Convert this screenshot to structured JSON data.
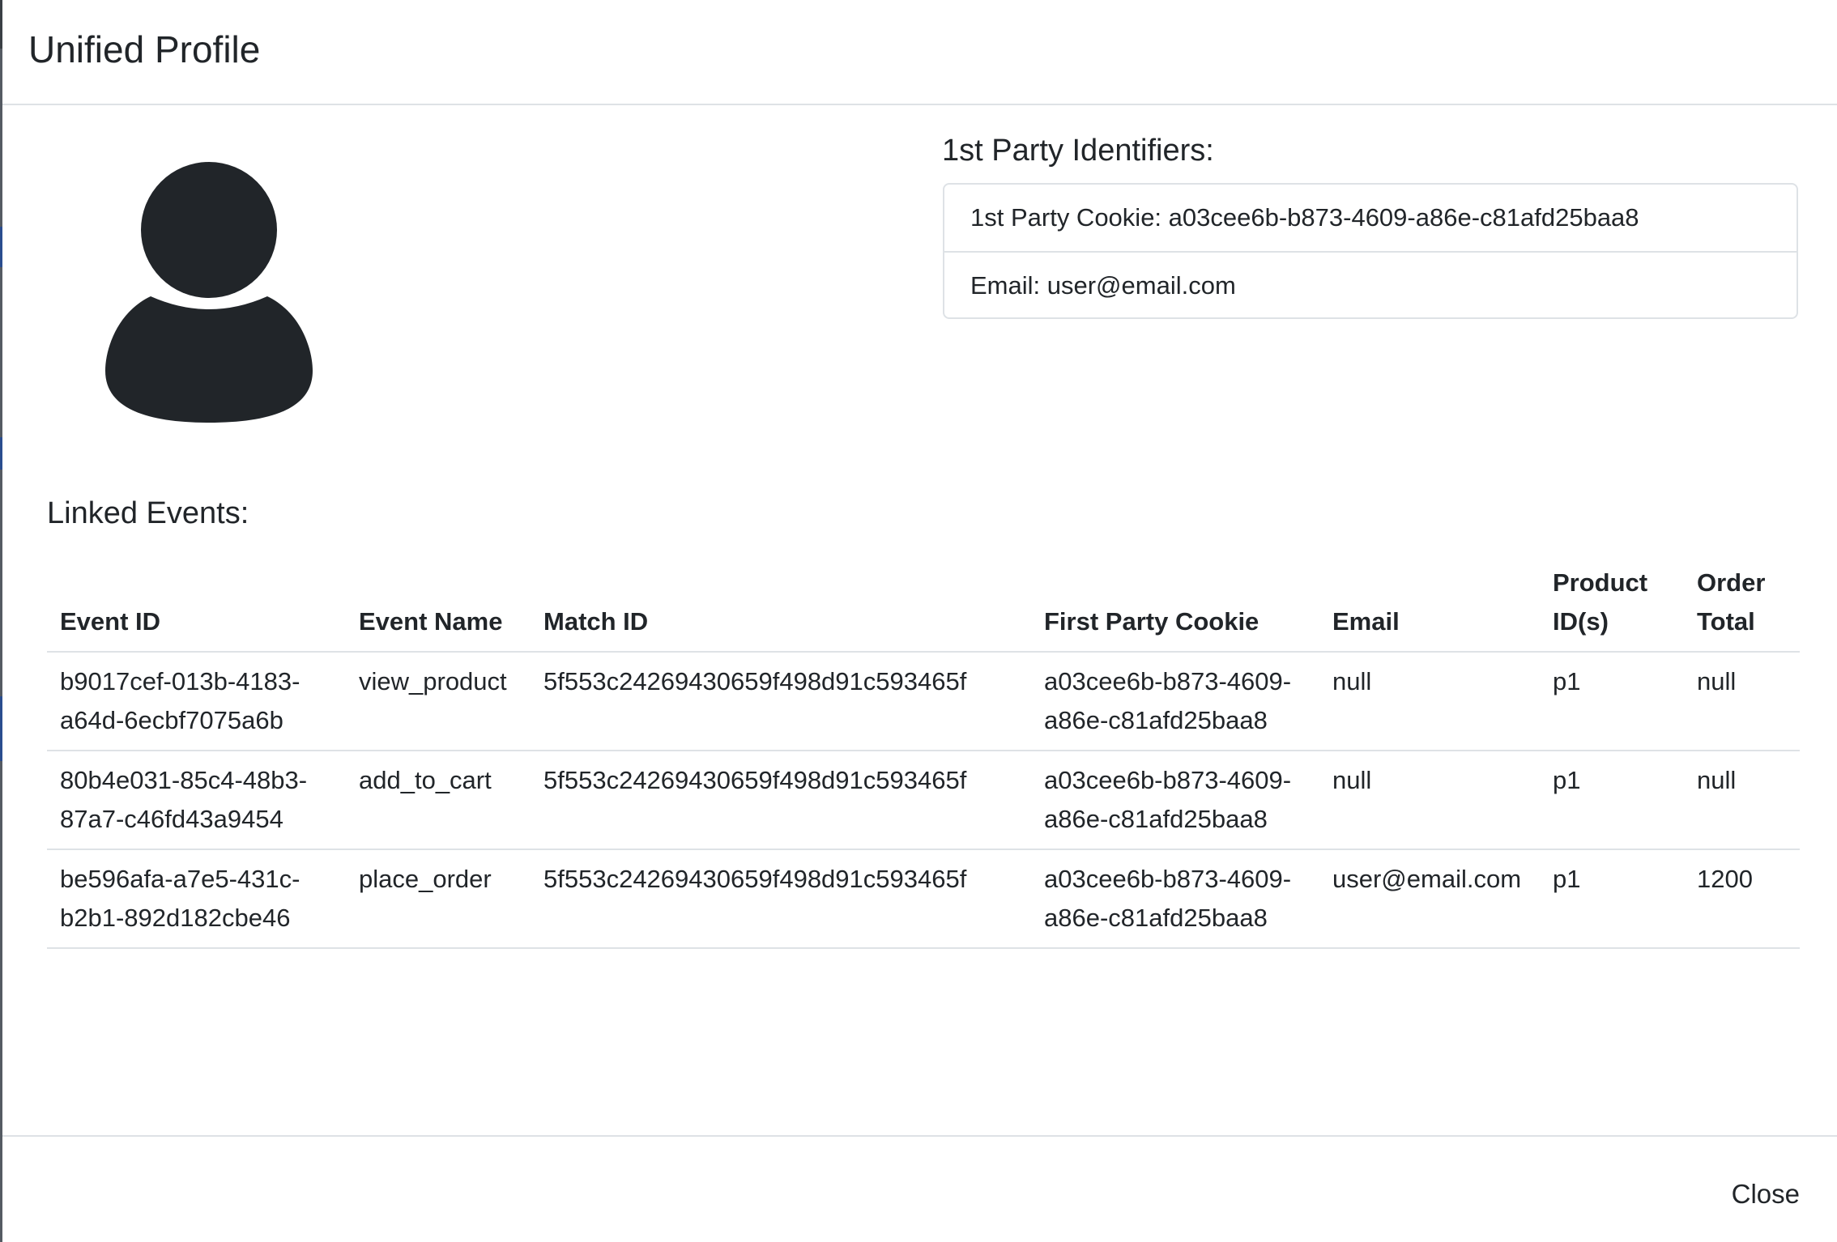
{
  "modal": {
    "title": "Unified Profile"
  },
  "profile": {
    "avatar_icon": "user-silhouette-icon"
  },
  "identifiers": {
    "heading": "1st Party Identifiers:",
    "items": [
      "1st Party Cookie: a03cee6b-b873-4609-a86e-c81afd25baa8",
      "Email: user@email.com"
    ]
  },
  "events": {
    "heading": "Linked Events:",
    "columns": [
      "Event ID",
      "Event Name",
      "Match ID",
      "First Party Cookie",
      "Email",
      "Product ID(s)",
      "Order Total"
    ],
    "rows": [
      [
        "b9017cef-013b-4183-a64d-6ecbf7075a6b",
        "view_product",
        "5f553c24269430659f498d91c593465f",
        "a03cee6b-b873-4609-a86e-c81afd25baa8",
        "null",
        "p1",
        "null"
      ],
      [
        "80b4e031-85c4-48b3-87a7-c46fd43a9454",
        "add_to_cart",
        "5f553c24269430659f498d91c593465f",
        "a03cee6b-b873-4609-a86e-c81afd25baa8",
        "null",
        "p1",
        "null"
      ],
      [
        "be596afa-a7e5-431c-b2b1-892d182cbe46",
        "place_order",
        "5f553c24269430659f498d91c593465f",
        "a03cee6b-b873-4609-a86e-c81afd25baa8",
        "user@email.com",
        "p1",
        "1200"
      ]
    ]
  },
  "footer": {
    "close_label": "Close"
  },
  "colors": {
    "text": "#212529",
    "border": "#dee2e6",
    "icon": "#212529"
  }
}
